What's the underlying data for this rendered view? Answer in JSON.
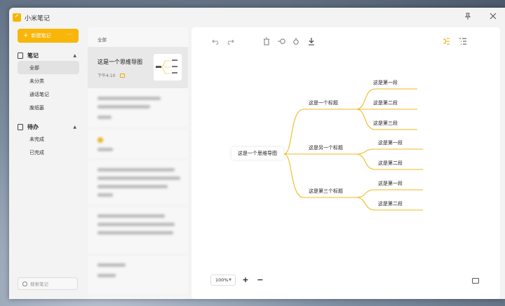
{
  "app": {
    "title": "小米笔记"
  },
  "titlebar_icons": [
    "pin-icon",
    "close-icon"
  ],
  "sidebar": {
    "new_note_label": "新建笔记",
    "more_label": "···",
    "notes_group": {
      "label": "笔记",
      "items": [
        {
          "label": "全部",
          "active": true
        },
        {
          "label": "未分类",
          "active": false
        },
        {
          "label": "通话笔记",
          "active": false
        },
        {
          "label": "废纸篓",
          "active": false
        }
      ]
    },
    "todo_group": {
      "label": "待办",
      "items": [
        {
          "label": "未完成"
        },
        {
          "label": "已完成"
        }
      ]
    },
    "search_placeholder": "搜索笔记"
  },
  "notelist": {
    "header": "全部",
    "active_note": {
      "title": "这是一个思维导图",
      "time": "下午4:10"
    }
  },
  "editor": {
    "toolbar": [
      "undo-icon",
      "redo-icon",
      "delete-icon",
      "insert-before-icon",
      "insert-after-icon",
      "download-icon",
      "mindmap-view-icon",
      "outline-view-icon"
    ],
    "zoom": "100%",
    "zoom_in": "+",
    "zoom_out": "−",
    "mindmap": {
      "root": "这是一个思维导图",
      "branches": [
        {
          "title": "这是一个标题",
          "children": [
            "这是第一段",
            "这是第二段",
            "这是第三段"
          ]
        },
        {
          "title": "这是另一个标题",
          "children": [
            "这是第一段",
            "这是第二段"
          ]
        },
        {
          "title": "这是第三个标题",
          "children": [
            "这是第一段",
            "这是第二段"
          ]
        }
      ],
      "line_color": "#f2b81e"
    }
  },
  "colors": {
    "accent": "#f8b60a"
  }
}
